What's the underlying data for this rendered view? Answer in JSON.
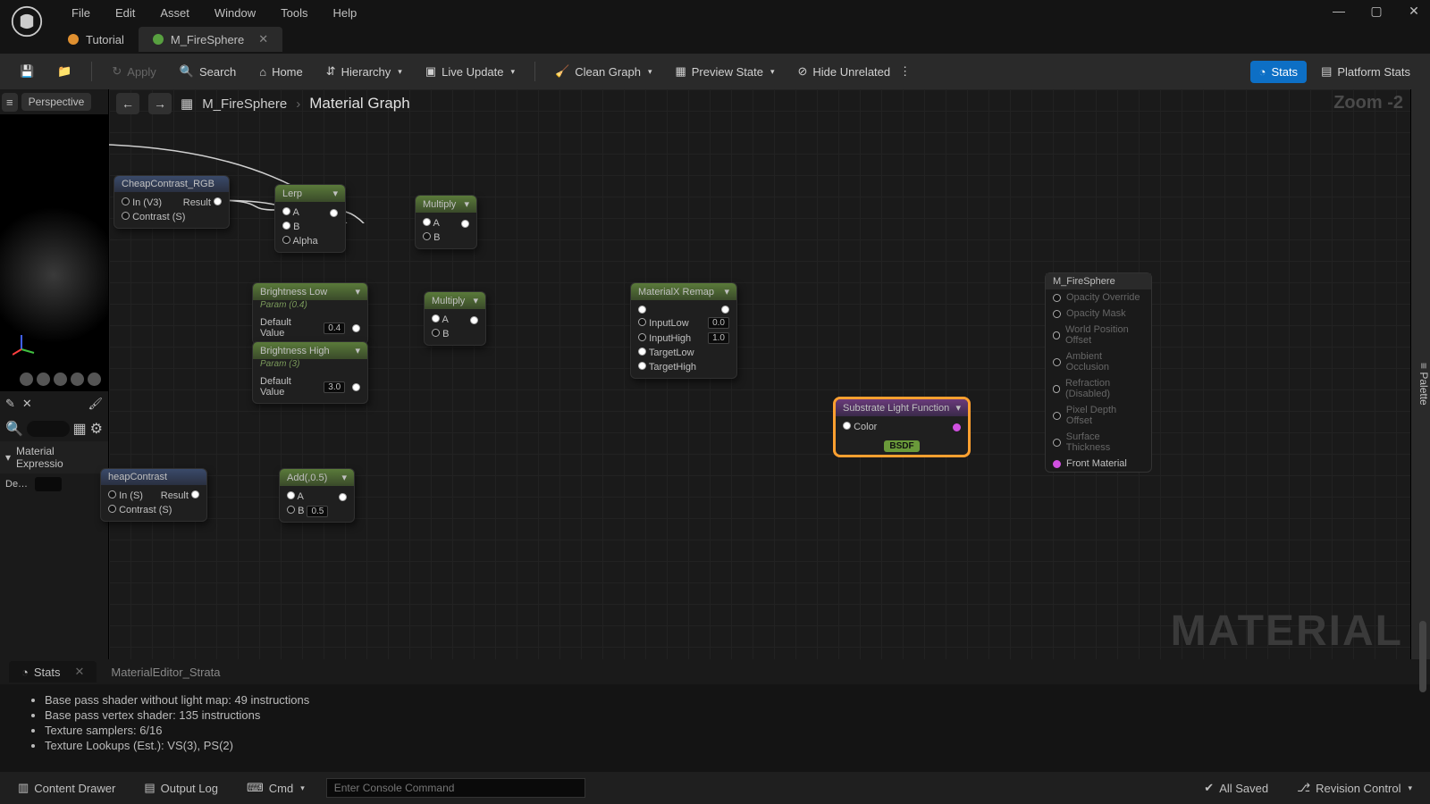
{
  "menu": {
    "items": [
      "File",
      "Edit",
      "Asset",
      "Window",
      "Tools",
      "Help"
    ]
  },
  "tabs": [
    {
      "label": "Tutorial",
      "icon_color": "#e09030"
    },
    {
      "label": "M_FireSphere",
      "icon_color": "#58a040",
      "active": true
    }
  ],
  "toolbar": {
    "apply": "Apply",
    "search": "Search",
    "home": "Home",
    "hierarchy": "Hierarchy",
    "live_update": "Live Update",
    "clean_graph": "Clean Graph",
    "preview_state": "Preview State",
    "hide_unrelated": "Hide Unrelated",
    "stats": "Stats",
    "platform_stats": "Platform Stats"
  },
  "breadcrumb": {
    "name": "M_FireSphere",
    "sub": "Material Graph",
    "zoom": "Zoom -2",
    "palette": "Palette"
  },
  "viewport": {
    "perspective": "Perspective"
  },
  "details": {
    "section": "Material Expressio",
    "row": "De…"
  },
  "nodes": {
    "cheap_rgb": {
      "title": "CheapContrast_RGB",
      "p_in": "In (V3)",
      "p_contrast": "Contrast (S)",
      "p_result": "Result"
    },
    "lerp": {
      "title": "Lerp",
      "a": "A",
      "b": "B",
      "alpha": "Alpha"
    },
    "mult1": {
      "title": "Multiply",
      "a": "A",
      "b": "B"
    },
    "bright_low": {
      "title": "Brightness Low",
      "sub": "Param (0.4)",
      "def": "Default Value",
      "val": "0.4"
    },
    "bright_high": {
      "title": "Brightness High",
      "sub": "Param (3)",
      "def": "Default Value",
      "val": "3.0"
    },
    "mult2": {
      "title": "Multiply",
      "a": "A",
      "b": "B"
    },
    "remap": {
      "title": "MaterialX Remap",
      "in_low": "InputLow",
      "in_low_v": "0.0",
      "in_high": "InputHigh",
      "in_high_v": "1.0",
      "t_low": "TargetLow",
      "t_high": "TargetHigh"
    },
    "cheap": {
      "title": "heapContrast",
      "p_in": "In (S)",
      "p_contrast": "Contrast (S)",
      "p_result": "Result"
    },
    "add": {
      "title": "Add(,0.5)",
      "a": "A",
      "b": "B",
      "bval": "0.5"
    },
    "slf": {
      "title": "Substrate Light Function",
      "color": "Color",
      "badge": "BSDF"
    },
    "out": {
      "title": "M_FireSphere",
      "pins": [
        "Opacity Override",
        "Opacity Mask",
        "World Position Offset",
        "Ambient Occlusion",
        "Refraction (Disabled)",
        "Pixel Depth Offset",
        "Surface Thickness",
        "Front Material"
      ]
    }
  },
  "bottom": {
    "tab1": "Stats",
    "tab2": "MaterialEditor_Strata",
    "lines": [
      "Base pass shader without light map: 49 instructions",
      "Base pass vertex shader: 135 instructions",
      "Texture samplers: 6/16",
      "Texture Lookups (Est.): VS(3), PS(2)"
    ]
  },
  "status": {
    "drawer": "Content Drawer",
    "log": "Output Log",
    "cmd": "Cmd",
    "cmd_ph": "Enter Console Command",
    "saved": "All Saved",
    "rev": "Revision Control"
  },
  "watermark": "MATERIAL"
}
